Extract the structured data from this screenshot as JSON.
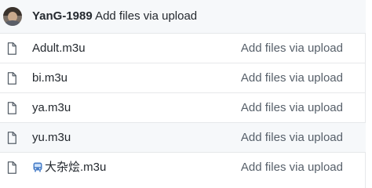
{
  "header": {
    "username": "YanG-1989",
    "commit_message": "Add files via upload"
  },
  "files": [
    {
      "name": "Adult.m3u",
      "commit_message": "Add files via upload",
      "icon": "file-icon"
    },
    {
      "name": "bi.m3u",
      "commit_message": "Add files via upload",
      "icon": "file-icon"
    },
    {
      "name": "ya.m3u",
      "commit_message": "Add files via upload",
      "icon": "file-icon"
    },
    {
      "name": "yu.m3u",
      "commit_message": "Add files via upload",
      "icon": "file-icon"
    },
    {
      "name": "大杂烩.m3u",
      "prefix_icon": "tram-emoji-icon",
      "commit_message": "Add files via upload",
      "icon": "file-icon"
    }
  ],
  "colors": {
    "header_bg": "#f6f8fa",
    "border": "#e6e8ea",
    "text": "#24292f",
    "muted_text": "#57606a",
    "emoji_blue": "#4a7fc8"
  }
}
